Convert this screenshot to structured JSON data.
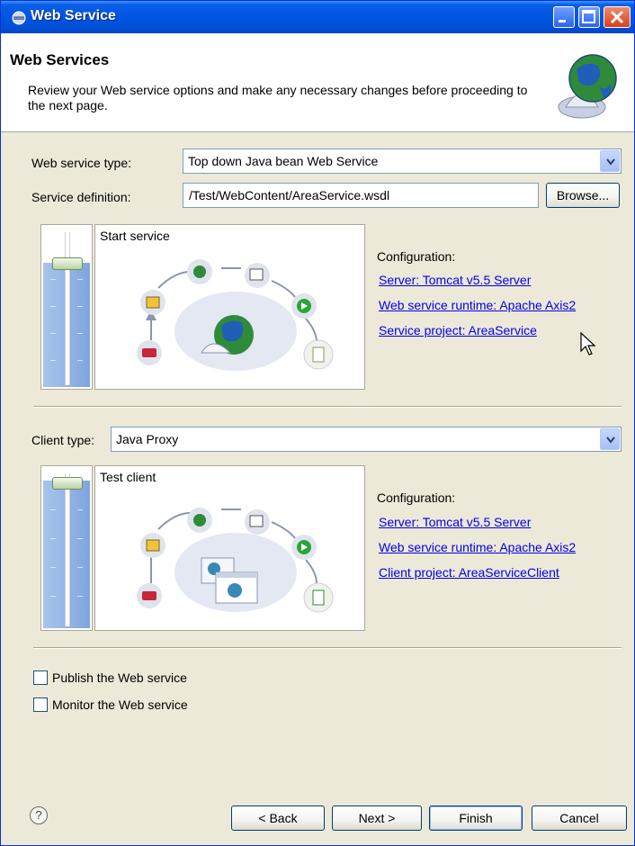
{
  "window": {
    "title": "Web Service"
  },
  "banner": {
    "title": "Web Services",
    "description": "Review your Web service options and make any necessary changes before proceeding to the next page."
  },
  "service": {
    "type_label": "Web service type:",
    "type_value": "Top down Java bean Web Service",
    "definition_label": "Service definition:",
    "definition_value": "/Test/WebContent/AreaService.wsdl",
    "browse_label": "Browse...",
    "diagram_title": "Start service",
    "config_title": "Configuration:",
    "links": {
      "server": "Server: Tomcat v5.5 Server",
      "runtime": "Web service runtime: Apache Axis2",
      "project": "Service project: AreaService"
    }
  },
  "client": {
    "type_label": "Client type:",
    "type_value": "Java Proxy",
    "diagram_title": "Test client",
    "config_title": "Configuration:",
    "links": {
      "server": "Server: Tomcat v5.5 Server",
      "runtime": "Web service runtime: Apache Axis2",
      "project": "Client project: AreaServiceClient"
    }
  },
  "options": {
    "publish_label": "Publish the Web service",
    "publish_checked": false,
    "monitor_label": "Monitor the Web service",
    "monitor_checked": false
  },
  "footer": {
    "help_glyph": "?",
    "back_label": "< Back",
    "next_label": "Next >",
    "finish_label": "Finish",
    "cancel_label": "Cancel"
  },
  "colors": {
    "title_bar": "#0054e3",
    "link": "#0000ee",
    "dialog_bg": "#ece9d8"
  }
}
